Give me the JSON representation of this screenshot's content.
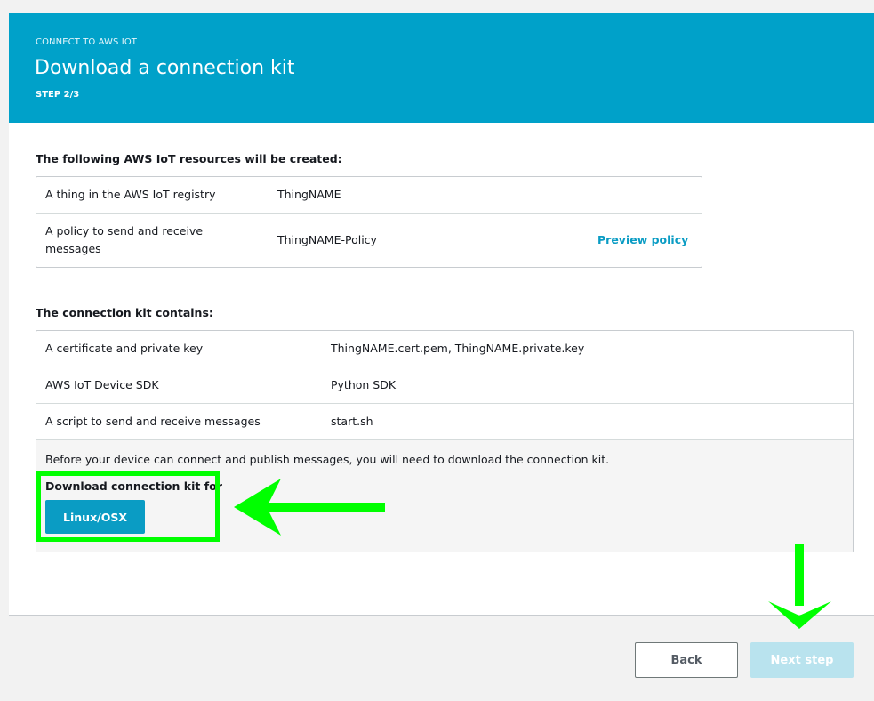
{
  "header": {
    "eyebrow": "CONNECT TO AWS IOT",
    "title": "Download a connection kit",
    "step": "STEP 2/3"
  },
  "resources": {
    "heading": "The following AWS IoT resources will be created:",
    "rows": [
      {
        "label": "A thing in the AWS IoT registry",
        "value": "ThingNAME"
      },
      {
        "label": "A policy to send and receive messages",
        "value": "ThingNAME-Policy",
        "action": "Preview policy"
      }
    ]
  },
  "kit": {
    "heading": "The connection kit contains:",
    "rows": [
      {
        "label": "A certificate and private key",
        "value": "ThingNAME.cert.pem, ThingNAME.private.key"
      },
      {
        "label": "AWS IoT Device SDK",
        "value": "Python SDK"
      },
      {
        "label": "A script to send and receive messages",
        "value": "start.sh"
      }
    ],
    "note": "Before your device can connect and publish messages, you will need to download the connection kit.",
    "download_label": "Download connection kit for",
    "download_button": "Linux/OSX"
  },
  "footer": {
    "back_label": "Back",
    "next_label": "Next step"
  },
  "colors": {
    "header_bg": "#00a1c9",
    "link": "#0a9cc4",
    "primary_button": "#0a9cc4",
    "disabled_button": "#b9e3ee",
    "annotation": "#00ff00"
  }
}
